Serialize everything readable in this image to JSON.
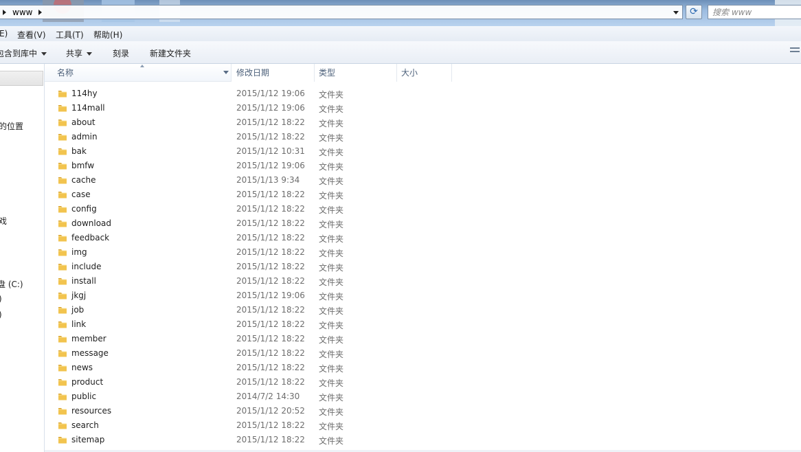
{
  "address_bar": {
    "segment": "www",
    "refresh_glyph": "⟳"
  },
  "search": {
    "placeholder": "搜索 www"
  },
  "menu": {
    "items": [
      "E)",
      "查看(V)",
      "工具(T)",
      "帮助(H)"
    ]
  },
  "toolbar": {
    "include_library_label": "包含到库中",
    "share_label": "共享",
    "burn_label": "刻录",
    "new_folder_label": "新建文件夹"
  },
  "nav": {
    "items": [
      "的位置",
      "戏",
      "盘 (C:)",
      ")",
      ")",
      ")"
    ]
  },
  "columns": {
    "name": "名称",
    "modified": "修改日期",
    "type": "类型",
    "size": "大小"
  },
  "colors": {
    "folder": "#f2c44f",
    "folder_dark": "#d9a22a",
    "header_text": "#4c607a",
    "detail_text": "#6d6d6d"
  },
  "files": [
    {
      "name": "114hy",
      "modified": "2015/1/12 19:06",
      "type": "文件夹"
    },
    {
      "name": "114mall",
      "modified": "2015/1/12 19:06",
      "type": "文件夹"
    },
    {
      "name": "about",
      "modified": "2015/1/12 18:22",
      "type": "文件夹"
    },
    {
      "name": "admin",
      "modified": "2015/1/12 18:22",
      "type": "文件夹"
    },
    {
      "name": "bak",
      "modified": "2015/1/12 10:31",
      "type": "文件夹"
    },
    {
      "name": "bmfw",
      "modified": "2015/1/12 19:06",
      "type": "文件夹"
    },
    {
      "name": "cache",
      "modified": "2015/1/13 9:34",
      "type": "文件夹"
    },
    {
      "name": "case",
      "modified": "2015/1/12 18:22",
      "type": "文件夹"
    },
    {
      "name": "config",
      "modified": "2015/1/12 18:22",
      "type": "文件夹"
    },
    {
      "name": "download",
      "modified": "2015/1/12 18:22",
      "type": "文件夹"
    },
    {
      "name": "feedback",
      "modified": "2015/1/12 18:22",
      "type": "文件夹"
    },
    {
      "name": "img",
      "modified": "2015/1/12 18:22",
      "type": "文件夹"
    },
    {
      "name": "include",
      "modified": "2015/1/12 18:22",
      "type": "文件夹"
    },
    {
      "name": "install",
      "modified": "2015/1/12 18:22",
      "type": "文件夹"
    },
    {
      "name": "jkgj",
      "modified": "2015/1/12 19:06",
      "type": "文件夹"
    },
    {
      "name": "job",
      "modified": "2015/1/12 18:22",
      "type": "文件夹"
    },
    {
      "name": "link",
      "modified": "2015/1/12 18:22",
      "type": "文件夹"
    },
    {
      "name": "member",
      "modified": "2015/1/12 18:22",
      "type": "文件夹"
    },
    {
      "name": "message",
      "modified": "2015/1/12 18:22",
      "type": "文件夹"
    },
    {
      "name": "news",
      "modified": "2015/1/12 18:22",
      "type": "文件夹"
    },
    {
      "name": "product",
      "modified": "2015/1/12 18:22",
      "type": "文件夹"
    },
    {
      "name": "public",
      "modified": "2014/7/2 14:30",
      "type": "文件夹"
    },
    {
      "name": "resources",
      "modified": "2015/1/12 20:52",
      "type": "文件夹"
    },
    {
      "name": "search",
      "modified": "2015/1/12 18:22",
      "type": "文件夹"
    },
    {
      "name": "sitemap",
      "modified": "2015/1/12 18:22",
      "type": "文件夹"
    }
  ]
}
